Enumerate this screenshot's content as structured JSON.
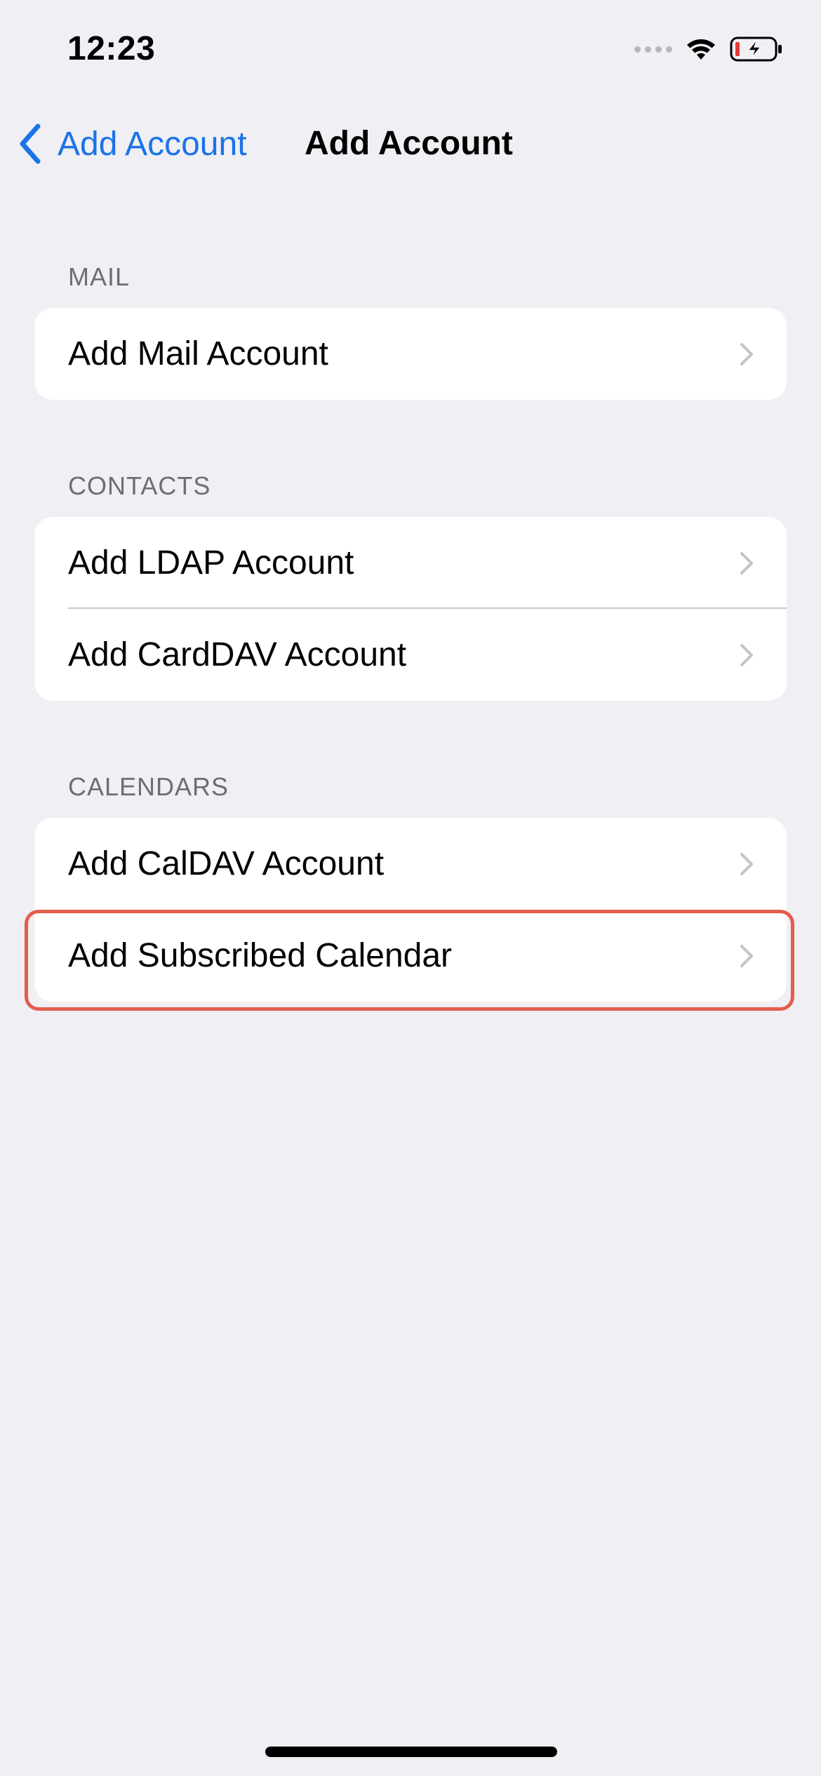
{
  "status_bar": {
    "time": "12:23",
    "icons": [
      "signal-icon",
      "wifi-icon",
      "battery-charging-icon"
    ],
    "battery_level_color": "#e53935"
  },
  "nav": {
    "back_label": "Add Account",
    "title": "Add Account"
  },
  "sections": [
    {
      "header": "MAIL",
      "rows": [
        {
          "label": "Add Mail Account"
        }
      ]
    },
    {
      "header": "CONTACTS",
      "rows": [
        {
          "label": "Add LDAP Account"
        },
        {
          "label": "Add CardDAV Account"
        }
      ]
    },
    {
      "header": "CALENDARS",
      "rows": [
        {
          "label": "Add CalDAV Account"
        },
        {
          "label": "Add Subscribed Calendar"
        }
      ]
    }
  ],
  "colors": {
    "accent": "#1a73e8",
    "background": "#efeff4",
    "highlight_border": "#e35d4d"
  }
}
